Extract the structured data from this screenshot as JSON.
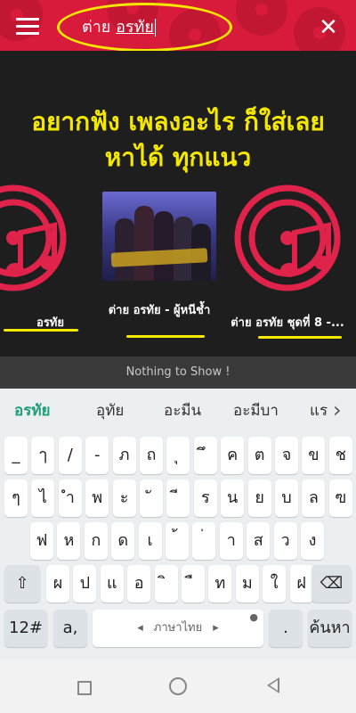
{
  "colors": {
    "brand": "#d81b3a",
    "highlight": "#f5e800",
    "background": "#1e1e1e",
    "suggestion_active": "#1e9e7a"
  },
  "header": {
    "menu_icon": "hamburger-menu-icon",
    "search_prefix": "ต่าย",
    "search_underlined": "อรทัย",
    "close_icon": "close-icon",
    "close_glyph": "✕"
  },
  "hero": {
    "line1": "อยากฟัง เพลงอะไร ก็ใส่เลย",
    "line2": "หาได้ ทุกแนว"
  },
  "results": [
    {
      "title": "อรทัย",
      "icon": "music-disc-icon"
    },
    {
      "title": "ต่าย อรทัย - ผู้หนีช้ำ",
      "icon": "album-cover-image"
    },
    {
      "title": "ต่าย อรทัย ชุดที่ 8 -...",
      "icon": "music-disc-icon"
    }
  ],
  "status": {
    "empty_message": "Nothing to Show !"
  },
  "keyboard": {
    "suggestions": [
      "อรทัย",
      "อุทัย",
      "อะมีน",
      "อะมีบา",
      "แร"
    ],
    "suggestion_more_icon": "chevron-right-icon",
    "row1": [
      "_",
      "ๅ",
      "/",
      "-",
      "ภ",
      "ถ",
      "ุ",
      "ึ",
      "ค",
      "ต",
      "จ",
      "ข",
      "ช"
    ],
    "row2": [
      "ๆ",
      "ไ",
      "ำ",
      "พ",
      "ะ",
      "ั",
      "ี",
      "ร",
      "น",
      "ย",
      "บ",
      "ล",
      "ฃ"
    ],
    "row3": [
      "ฟ",
      "ห",
      "ก",
      "ด",
      "เ",
      "้",
      "่",
      "า",
      "ส",
      "ว",
      "ง"
    ],
    "row4": [
      "ผ",
      "ป",
      "แ",
      "อ",
      "ิ",
      "ื",
      "ท",
      "ม",
      "ใ",
      "ฝ"
    ],
    "shift_glyph": "⇧",
    "backspace_glyph": "⌫",
    "numbers_key": "12#",
    "symbols_key": "a,",
    "space_label": "ภาษาไทย",
    "space_left_arrow": "◂",
    "space_right_arrow": "▸",
    "mic_glyph": "🎤",
    "period_key": ".",
    "search_key": "ค้นหา"
  },
  "navbar": {
    "recent_icon": "square-icon",
    "home_icon": "circle-home-icon",
    "back_icon": "triangle-back-icon"
  }
}
